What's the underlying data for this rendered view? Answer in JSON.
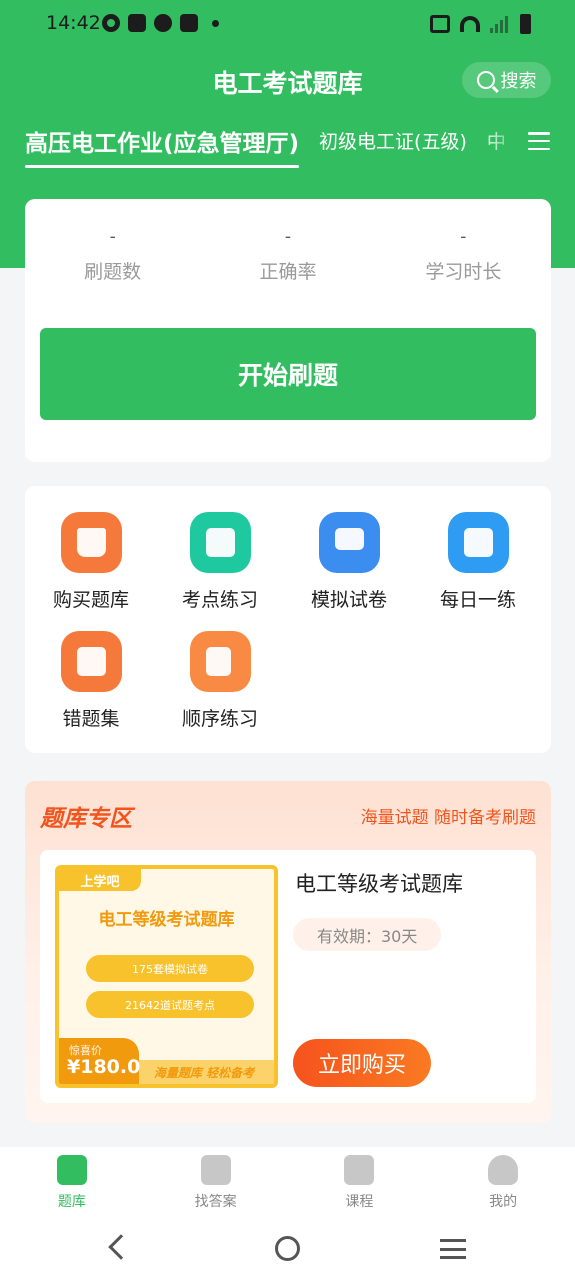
{
  "status_bar": {
    "time": "14:42"
  },
  "header": {
    "title": "电工考试题库",
    "search_label": "搜索",
    "tabs": [
      {
        "label": "高压电工作业(应急管理厅)",
        "active": true
      },
      {
        "label": "初级电工证(五级)",
        "active": false
      },
      {
        "label": "中",
        "active": false
      }
    ]
  },
  "stats": {
    "items": [
      {
        "value": "-",
        "label": "刷题数"
      },
      {
        "value": "-",
        "label": "正确率"
      },
      {
        "value": "-",
        "label": "学习时长"
      }
    ],
    "start_label": "开始刷题"
  },
  "features": [
    {
      "label": "购买题库",
      "icon": "cart-icon"
    },
    {
      "label": "考点练习",
      "icon": "star-book-icon"
    },
    {
      "label": "模拟试卷",
      "icon": "presentation-icon"
    },
    {
      "label": "每日一练",
      "icon": "calendar-check-icon"
    },
    {
      "label": "错题集",
      "icon": "wrong-book-icon"
    },
    {
      "label": "顺序练习",
      "icon": "document-edit-icon"
    }
  ],
  "promo": {
    "title": "题库专区",
    "subtitle": "海量试题 随时备考刷题",
    "product": {
      "cover_logo": "上学吧",
      "cover_title": "电工等级考试题库",
      "cover_pills": [
        "175套模拟试卷",
        "21642道试题考点"
      ],
      "price_label": "惊喜价",
      "price": "¥180.0",
      "cover_tag": "海量题库 轻松备考",
      "name": "电工等级考试题库",
      "validity": "有效期：30天",
      "buy_label": "立即购买"
    }
  },
  "bottom_nav": [
    {
      "label": "题库",
      "icon": "question-bank-icon",
      "active": true
    },
    {
      "label": "找答案",
      "icon": "search-answer-icon",
      "active": false
    },
    {
      "label": "课程",
      "icon": "video-play-icon",
      "active": false
    },
    {
      "label": "我的",
      "icon": "profile-icon",
      "active": false
    }
  ],
  "colors": {
    "primary": "#32bd60",
    "promo_accent": "#f2541d",
    "cover_yellow": "#f8c22c"
  }
}
